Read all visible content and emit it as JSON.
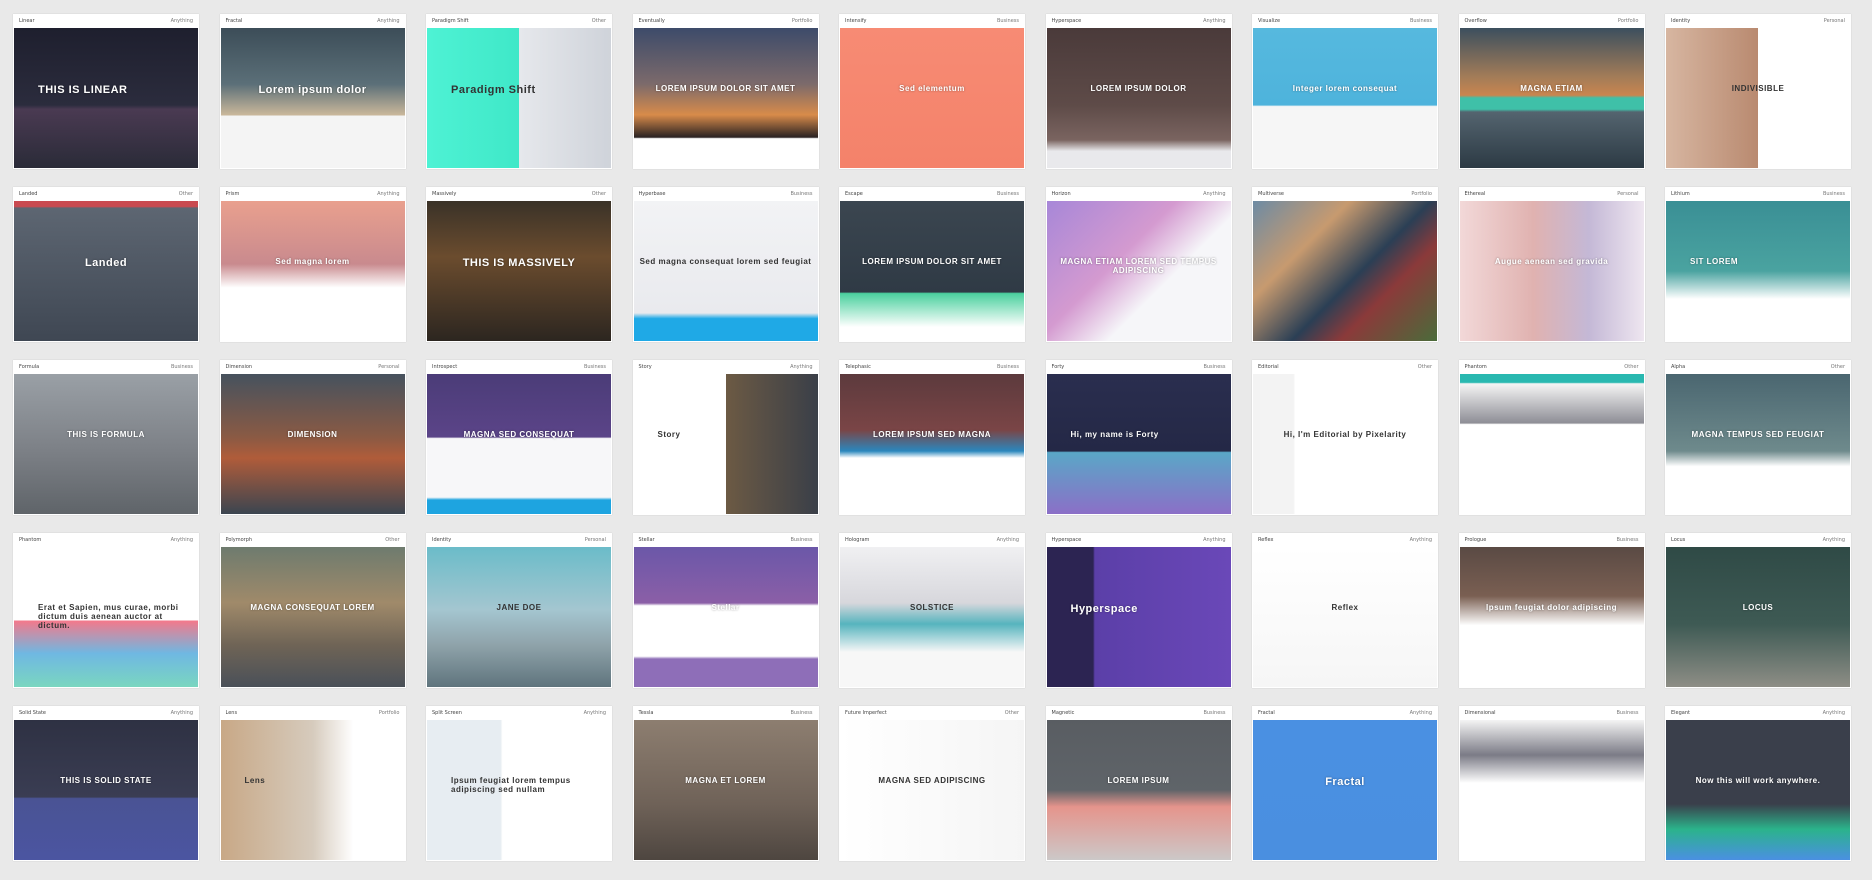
{
  "cards": [
    {
      "name": "Linear",
      "category": "Anything",
      "headline": "THIS IS LINEAR",
      "bg": "linear-gradient(180deg,#1e1f2e 0%,#2b2c3d 55%,#4a3a52 58%,#2a2b38 100%)",
      "tone": "light",
      "align": "left",
      "size": "big",
      "bar": false
    },
    {
      "name": "Fractal",
      "category": "Anything",
      "headline": "Lorem ipsum dolor",
      "bg": "linear-gradient(180deg,#3c4d58 0%,#5b6f78 40%,#c9b79a 62%,#f4f4f4 63%)",
      "tone": "light",
      "align": "center",
      "size": "big",
      "bar": false
    },
    {
      "name": "Paradigm Shift",
      "category": "Other",
      "headline": "Paradigm Shift",
      "bg": "linear-gradient(90deg,#4ef2d4 0%,#3fe8c8 50%,#e6e8ec 50%,#cfd3da 100%)",
      "tone": "dark",
      "align": "left",
      "size": "big",
      "bar": false
    },
    {
      "name": "Eventually",
      "category": "Portfolio",
      "headline": "LOREM IPSUM DOLOR SIT AMET",
      "bg": "linear-gradient(180deg,#3d4b6a 0%,#7c6a6b 40%,#d88b4a 62%,#2a2323 78%,#ffffff 79%)",
      "tone": "light",
      "align": "center",
      "size": "small",
      "bar": false
    },
    {
      "name": "Intensify",
      "category": "Business",
      "headline": "Sed elementum",
      "bg": "linear-gradient(180deg,#f78b74 0%,#f4826a 100%)",
      "tone": "light",
      "align": "center",
      "size": "small",
      "bar": false
    },
    {
      "name": "Hyperspace",
      "category": "Anything",
      "headline": "LOREM IPSUM DOLOR",
      "bg": "linear-gradient(180deg,#4a3a3a 0%,#5e4b48 55%,#7a6460 80%,#e9e9ec 88%)",
      "tone": "light",
      "align": "center",
      "size": "small",
      "bar": false
    },
    {
      "name": "Visualize",
      "category": "Business",
      "headline": "Integer lorem consequat",
      "bg": "linear-gradient(180deg,#56b9de 0%,#4eb3dc 55%,#f6f6f6 56%)",
      "tone": "light",
      "align": "center",
      "size": "small",
      "bar": false
    },
    {
      "name": "Overflow",
      "category": "Portfolio",
      "headline": "MAGNA ETIAM",
      "bg": "linear-gradient(180deg,#3c4f5e 0%,#a37c58 35%,#c9854f 48%,#3fc0a8 50%,#3fc0a8 58%,#54646f 60%,#2c3a44 100%)",
      "tone": "light",
      "align": "center",
      "size": "small",
      "bar": false
    },
    {
      "name": "Identity",
      "category": "Personal",
      "headline": "INDIVISIBLE",
      "bg": "linear-gradient(90deg,#d7b6a1 0%,#b98a70 50%,#ffffff 50%)",
      "tone": "dark",
      "align": "center",
      "size": "small",
      "bar": false
    },
    {
      "name": "Landed",
      "category": "Other",
      "headline": "Landed",
      "bg": "linear-gradient(180deg,#c94a50 0%,#c94a50 4%,#5d6672 5%,#3f4753 100%)",
      "tone": "light",
      "align": "center",
      "size": "big",
      "bar": false
    },
    {
      "name": "Prism",
      "category": "Anything",
      "headline": "Sed magna lorem",
      "bg": "linear-gradient(180deg,#e9a08e 0%,#c98a8e 45%,#ffffff 62%)",
      "tone": "light",
      "align": "center",
      "size": "small",
      "bar": false
    },
    {
      "name": "Massively",
      "category": "Other",
      "headline": "THIS IS MASSIVELY",
      "bg": "linear-gradient(180deg,#3a3228 0%,#6b4c2e 40%,#2c2620 100%)",
      "tone": "light",
      "align": "center",
      "size": "big",
      "bar": false
    },
    {
      "name": "Hyperbase",
      "category": "Business",
      "headline": "Sed magna consequat lorem sed feugiat",
      "bg": "linear-gradient(180deg,#f2f3f5 0%,#e9eaee 80%,#1fa9e6 84%)",
      "tone": "dark",
      "align": "center",
      "size": "small",
      "bar": false
    },
    {
      "name": "Escape",
      "category": "Business",
      "headline": "LOREM IPSUM DOLOR SIT AMET",
      "bg": "linear-gradient(180deg,#3b4650 0%,#2f3a45 65%,#4ad09e 66%,#ffffff 90%)",
      "tone": "light",
      "align": "center",
      "size": "small",
      "bar": false
    },
    {
      "name": "Horizon",
      "category": "Anything",
      "headline": "MAGNA ETIAM LOREM SED TEMPUS ADIPISCING",
      "bg": "linear-gradient(135deg,#a787d8 0%,#d49ad0 40%,#f6f6f9 62%)",
      "tone": "light",
      "align": "center",
      "size": "small",
      "bar": false
    },
    {
      "name": "Multiverse",
      "category": "Portfolio",
      "headline": "",
      "bg": "linear-gradient(135deg,#6d8ba4 0%,#c79a6f 30%,#2b3f55 55%,#8b3a3a 70%,#4a6b3a 100%)",
      "tone": "light",
      "align": "center",
      "size": "small",
      "bar": false
    },
    {
      "name": "Ethereal",
      "category": "Personal",
      "headline": "Augue aenean sed gravida",
      "bg": "linear-gradient(90deg,#f2d8d8 0%,#e0b2b0 40%,#c4b8d6 70%,#eee6f0 100%)",
      "tone": "light",
      "align": "center",
      "size": "small",
      "bar": false
    },
    {
      "name": "Lithium",
      "category": "Business",
      "headline": "SIT LOREM",
      "bg": "linear-gradient(180deg,#3a8f95 0%,#4aa3a0 50%,#ffffff 70%)",
      "tone": "light",
      "align": "left",
      "size": "small",
      "bar": false
    },
    {
      "name": "Formula",
      "category": "Business",
      "headline": "THIS IS FORMULA",
      "bg": "linear-gradient(180deg,#9aa0a6 0%,#7c8086 55%,#5f6469 100%)",
      "tone": "light",
      "align": "center",
      "size": "small",
      "bar": false
    },
    {
      "name": "Dimension",
      "category": "Personal",
      "headline": "DIMENSION",
      "bg": "linear-gradient(180deg,#46525e 0%,#8a5a44 45%,#b05c3a 60%,#3b4550 100%)",
      "tone": "light",
      "align": "center",
      "size": "small",
      "bar": false
    },
    {
      "name": "Introspect",
      "category": "Business",
      "headline": "MAGNA SED CONSEQUAT",
      "bg": "linear-gradient(180deg,#4b3c78 0%,#5b4488 45%,#f7f7f9 46%,#f7f7f9 88%,#1ea4e0 90%)",
      "tone": "light",
      "align": "center",
      "size": "small",
      "bar": false
    },
    {
      "name": "Story",
      "category": "Anything",
      "headline": "Story",
      "bg": "linear-gradient(90deg,#ffffff 0%,#ffffff 50%,#6c5a44 50%,#3a3f48 100%)",
      "tone": "dark",
      "align": "left",
      "size": "small",
      "bar": false
    },
    {
      "name": "Telephasic",
      "category": "Business",
      "headline": "LOREM IPSUM SED MAGNA",
      "bg": "linear-gradient(180deg,#5c3a3d 0%,#7a4546 40%,#2b87bd 55%,#ffffff 60%)",
      "tone": "light",
      "align": "center",
      "size": "small",
      "bar": false
    },
    {
      "name": "Forty",
      "category": "Business",
      "headline": "Hi, my name is Forty",
      "bg": "linear-gradient(180deg,#2a2e4f 0%,#242846 55%,#5aa7c7 56%,#8b6fc7 100%)",
      "tone": "light",
      "align": "left",
      "size": "small",
      "bar": false
    },
    {
      "name": "Editorial",
      "category": "Other",
      "headline": "Hi, I'm Editorial by Pixelarity",
      "bg": "linear-gradient(90deg,#f3f3f3 0%,#f3f3f3 22%,#ffffff 23%)",
      "tone": "dark",
      "align": "center",
      "size": "small",
      "bar": false
    },
    {
      "name": "Phantom",
      "category": "Other",
      "headline": "",
      "bg": "linear-gradient(180deg,#29b8b0 0%,#29b8b0 6%,#f4f4f4 7%,#8e8e96 35%,#ffffff 36%)",
      "tone": "dark",
      "align": "center",
      "size": "small",
      "bar": false
    },
    {
      "name": "Alpha",
      "category": "Other",
      "headline": "MAGNA TEMPUS SED FEUGIAT",
      "bg": "linear-gradient(180deg,#4a6670 0%,#6e8a8c 55%,#ffffff 66%)",
      "tone": "light",
      "align": "center",
      "size": "small",
      "bar": false
    },
    {
      "name": "Phantom",
      "category": "Anything",
      "headline": "Erat et Sapien, mus curae, morbi dictum duis aenean auctor at dictum.",
      "bg": "linear-gradient(180deg,#ffffff 0%,#ffffff 52%,#f27a8c 53%,#6fb8e2 76%,#7ad6c0 100%)",
      "tone": "dark",
      "align": "left",
      "size": "small",
      "bar": false
    },
    {
      "name": "Polymorph",
      "category": "Other",
      "headline": "MAGNA CONSEQUAT LOREM",
      "bg": "linear-gradient(180deg,#6e7b6e 0%,#a08a6a 40%,#6f6456 70%,#4a5058 100%)",
      "tone": "light",
      "align": "center",
      "size": "small",
      "bar": false
    },
    {
      "name": "Identity",
      "category": "Personal",
      "headline": "JANE DOE",
      "bg": "linear-gradient(180deg,#6bbcc9 0%,#a4c6d0 45%,#8fa3aa 70%,#5f747d 100%)",
      "tone": "dark",
      "align": "center",
      "size": "small",
      "bar": false
    },
    {
      "name": "Stellar",
      "category": "Business",
      "headline": "Stellar",
      "bg": "linear-gradient(180deg,#6b57a8 0%,#8b5fa7 40%,#ffffff 42%,#ffffff 78%,#8e6eb8 80%)",
      "tone": "light",
      "align": "center",
      "size": "small",
      "bar": false
    },
    {
      "name": "Hologram",
      "category": "Anything",
      "headline": "SOLSTICE",
      "bg": "linear-gradient(180deg,#f0f0f2 0%,#d7d7dc 40%,#56b4be 55%,#f7f7f7 75%)",
      "tone": "dark",
      "align": "center",
      "size": "small",
      "bar": false
    },
    {
      "name": "Hyperspace",
      "category": "Anything",
      "headline": "Hyperspace",
      "bg": "linear-gradient(90deg,#2c2452 0%,#2c2452 25%,#5b3fa8 26%,#6a48b8 100%)",
      "tone": "light",
      "align": "left",
      "size": "big",
      "bar": false
    },
    {
      "name": "Reflex",
      "category": "Anything",
      "headline": "Reflex",
      "bg": "linear-gradient(180deg,#ffffff 0%,#f6f6f6 100%)",
      "tone": "dark",
      "align": "center",
      "size": "small",
      "bar": false
    },
    {
      "name": "Prologue",
      "category": "Business",
      "headline": "Ipsum feugiat dolor adipiscing",
      "bg": "linear-gradient(180deg,#5a4a44 0%,#7a5f52 35%,#ffffff 56%)",
      "tone": "light",
      "align": "center",
      "size": "small",
      "bar": false
    },
    {
      "name": "Locus",
      "category": "Anything",
      "headline": "LOCUS",
      "bg": "linear-gradient(180deg,#2f4a46 0%,#3e5a54 55%,#8e8e86 100%)",
      "tone": "light",
      "align": "center",
      "size": "small",
      "bar": false
    },
    {
      "name": "Solid State",
      "category": "Anything",
      "headline": "THIS IS SOLID STATE",
      "bg": "linear-gradient(180deg,#2e3143 0%,#3a3d53 55%,#4a5394 56%,#4b55a1 100%)",
      "tone": "light",
      "align": "center",
      "size": "small",
      "bar": false
    },
    {
      "name": "Lens",
      "category": "Portfolio",
      "headline": "Lens",
      "bg": "linear-gradient(90deg,#c8a886 0%,#d6cbbd 50%,#ffffff 72%)",
      "tone": "dark",
      "align": "left",
      "size": "small",
      "bar": false
    },
    {
      "name": "Split Screen",
      "category": "Anything",
      "headline": "Ipsum feugiat lorem tempus adipiscing sed nullam",
      "bg": "linear-gradient(90deg,#e7edf2 0%,#e7edf2 40%,#ffffff 41%)",
      "tone": "dark",
      "align": "left",
      "size": "small",
      "bar": false
    },
    {
      "name": "Tessla",
      "category": "Business",
      "headline": "MAGNA ET LOREM",
      "bg": "linear-gradient(180deg,#8d7e70 0%,#6f6258 60%,#4e4640 100%)",
      "tone": "light",
      "align": "center",
      "size": "small",
      "bar": false
    },
    {
      "name": "Future Imperfect",
      "category": "Other",
      "headline": "MAGNA SED ADIPISCING",
      "bg": "linear-gradient(90deg,#ffffff 0%,#f5f5f5 100%)",
      "tone": "dark",
      "align": "center",
      "size": "small",
      "bar": false
    },
    {
      "name": "Magnetic",
      "category": "Business",
      "headline": "LOREM IPSUM",
      "bg": "linear-gradient(180deg,#595d62 0%,#5f6469 50%,#e5948c 62%,#ccc8c8 100%)",
      "tone": "light",
      "align": "center",
      "size": "small",
      "bar": false
    },
    {
      "name": "Fractal",
      "category": "Anything",
      "headline": "Fractal",
      "bg": "linear-gradient(180deg,#4a90e2 0%,#4a8fe0 100%)",
      "tone": "light",
      "align": "center",
      "size": "big",
      "bar": false
    },
    {
      "name": "Dimensional",
      "category": "Business",
      "headline": "",
      "bg": "linear-gradient(180deg,#f4f4f4 0%,#7b7b86 25%,#ffffff 45%)",
      "tone": "dark",
      "align": "center",
      "size": "small",
      "bar": false
    },
    {
      "name": "Elegant",
      "category": "Anything",
      "headline": "Now this will work anywhere.",
      "bg": "linear-gradient(180deg,#3a3f4b 0%,#3a3f4b 60%,#2bb38b 78%,#4a90e2 100%)",
      "tone": "light",
      "align": "center",
      "size": "small",
      "bar": false
    }
  ]
}
